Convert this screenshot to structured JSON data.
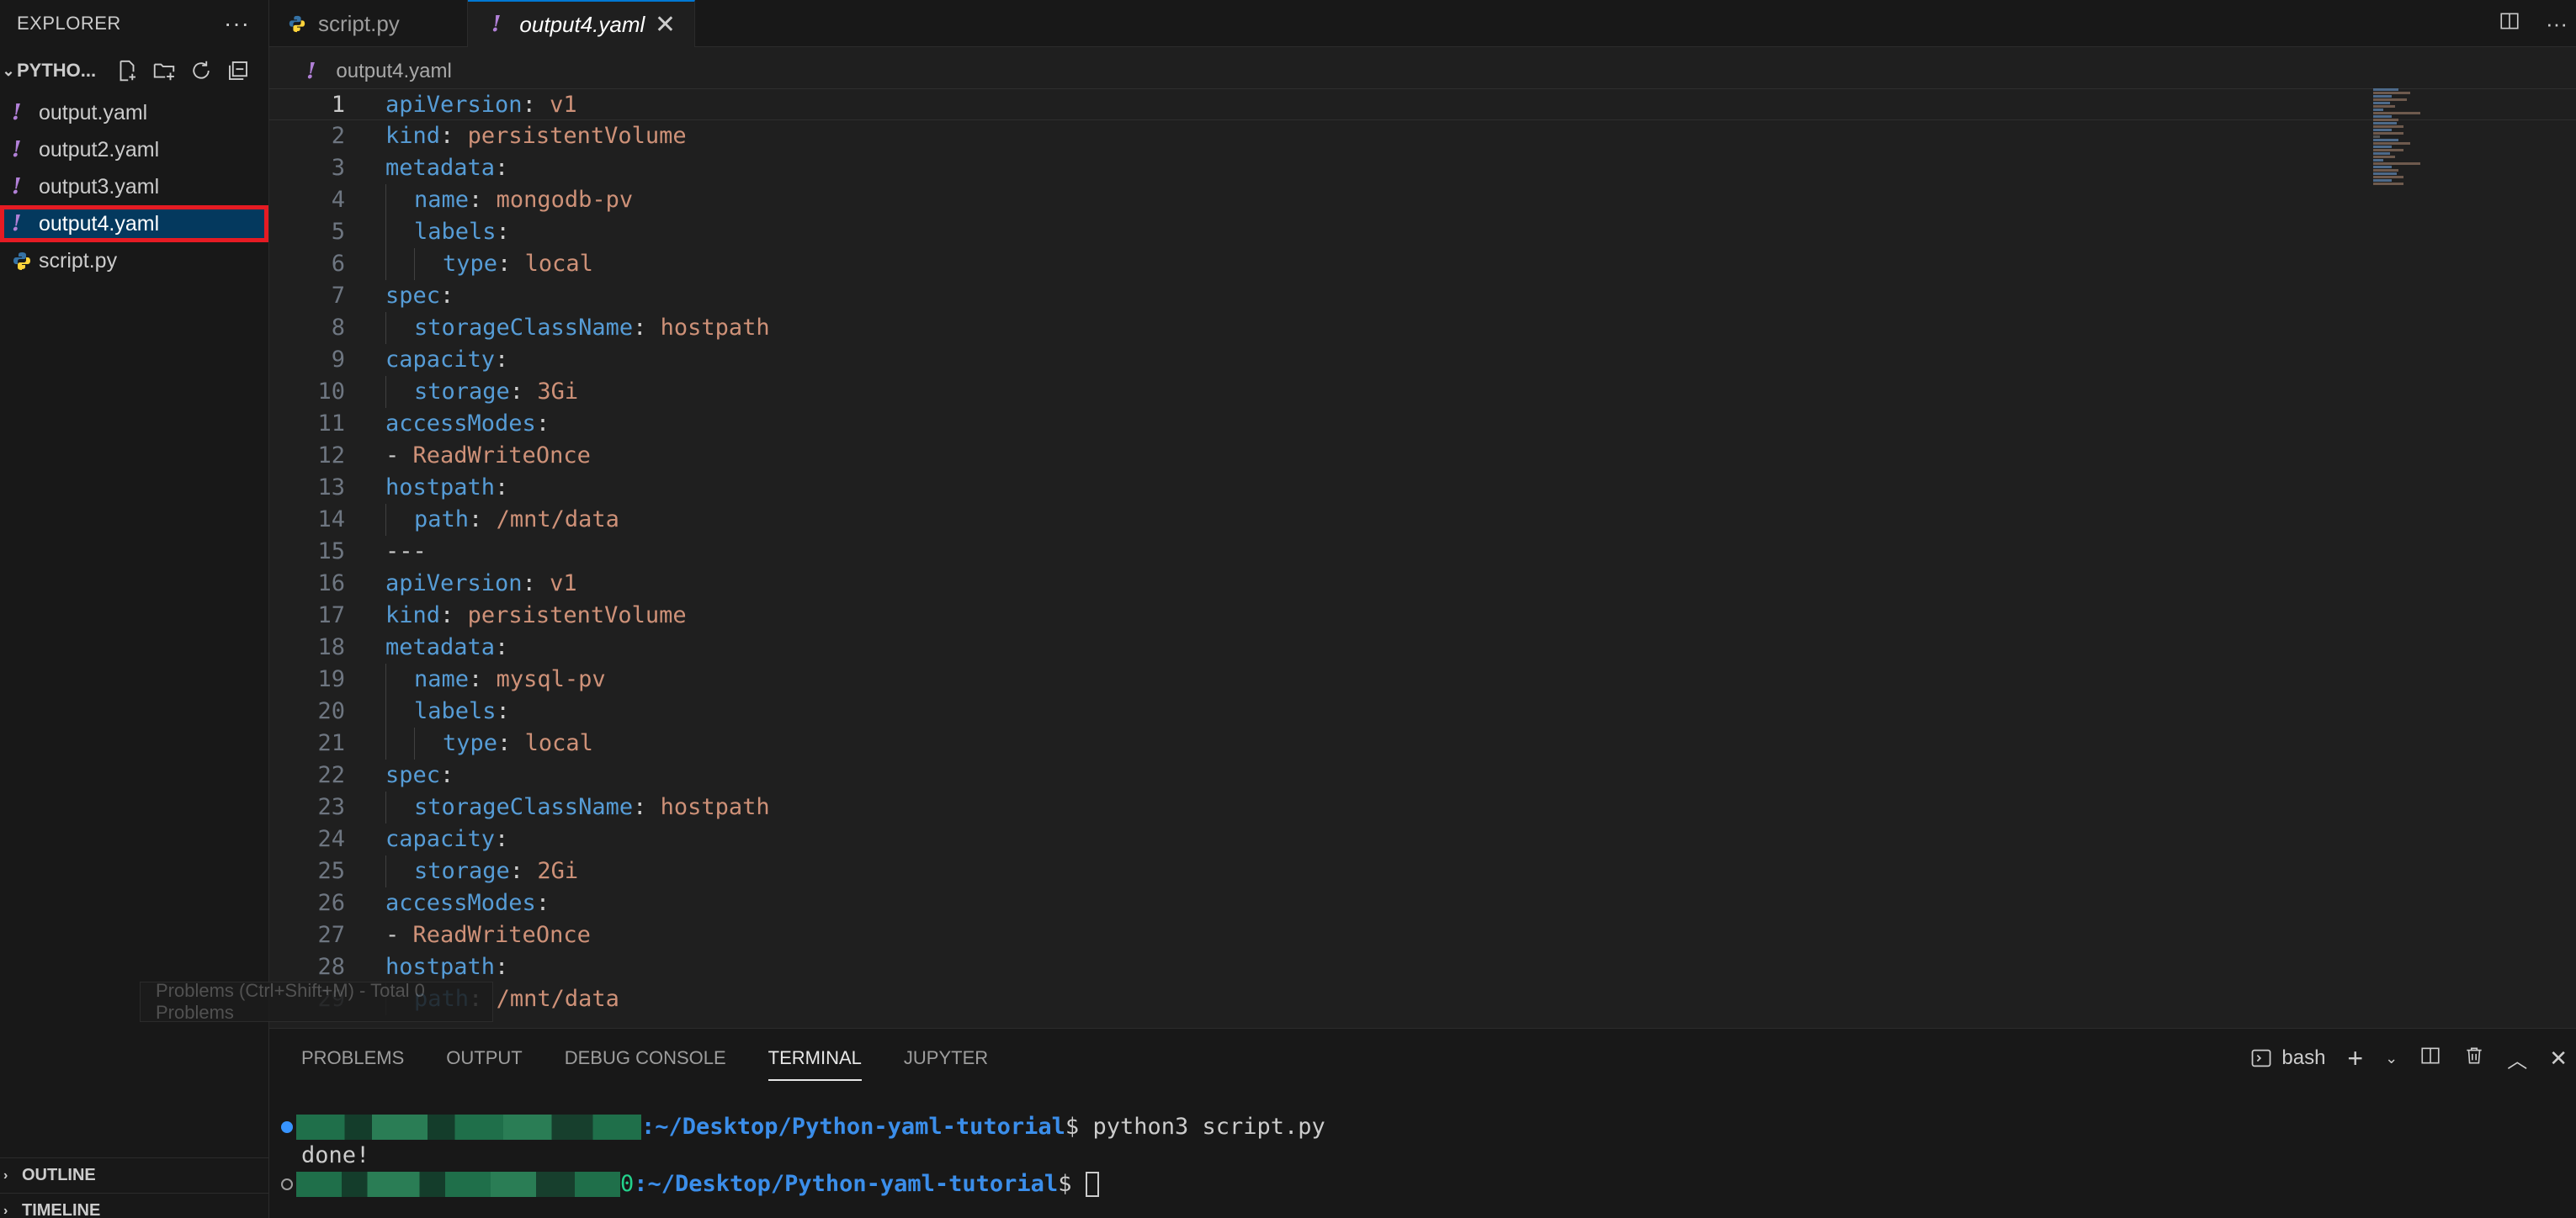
{
  "sidebar": {
    "title": "EXPLORER",
    "more": "···",
    "project": "PYTHO...",
    "files": [
      {
        "name": "output.yaml",
        "icon": "!"
      },
      {
        "name": "output2.yaml",
        "icon": "!"
      },
      {
        "name": "output3.yaml",
        "icon": "!"
      },
      {
        "name": "output4.yaml",
        "icon": "!"
      },
      {
        "name": "script.py",
        "icon": "python-icon"
      }
    ],
    "outline": "OUTLINE",
    "timeline": "TIMELINE"
  },
  "tabs": [
    {
      "label": "script.py"
    },
    {
      "label": "output4.yaml",
      "icon": "!"
    }
  ],
  "breadcrumb": {
    "icon": "!",
    "label": "output4.yaml"
  },
  "editor": {
    "lines": [
      "1",
      "2",
      "3",
      "4",
      "5",
      "6",
      "7",
      "8",
      "9",
      "10",
      "11",
      "12",
      "13",
      "14",
      "15",
      "16",
      "17",
      "18",
      "19",
      "20",
      "21",
      "22",
      "23",
      "24",
      "25",
      "26",
      "27",
      "28",
      "29"
    ],
    "t": {
      "apiVersion": "apiVersion",
      "kind": "kind",
      "metadata": "metadata",
      "name": "name",
      "labels": "labels",
      "type": "type",
      "spec": "spec",
      "storageClassName": "storageClassName",
      "capacity": "capacity",
      "storage": "storage",
      "accessModes": "accessModes",
      "hostpath": "hostpath",
      "path": "path",
      "colon": ":",
      "dash": "- ",
      "sep": "---",
      "v1": "v1",
      "pv": "persistentVolume",
      "mongo": "mongodb-pv",
      "mysql": "mysql-pv",
      "local": "local",
      "hostpathv": "hostpath",
      "g3": "3Gi",
      "g2": "2Gi",
      "rwo": "ReadWriteOnce",
      "mnt": "/mnt/data"
    }
  },
  "tooltip": "Problems (Ctrl+Shift+M) - Total 0 Problems",
  "panel": {
    "tabs": [
      "PROBLEMS",
      "OUTPUT",
      "DEBUG CONSOLE",
      "TERMINAL",
      "JUPYTER"
    ],
    "shell": "bash",
    "terminal": {
      "path": ":~/Desktop/Python-yaml-tutorial",
      "prompt": "$ ",
      "cmd": "python3 script.py",
      "output": "done!",
      "zero": "0"
    }
  },
  "colors": {
    "accent": "#0078d4",
    "highlight_border": "#e51b23",
    "key": "#569cd6",
    "value": "#ce9178",
    "yaml_icon": "#b180d7"
  }
}
